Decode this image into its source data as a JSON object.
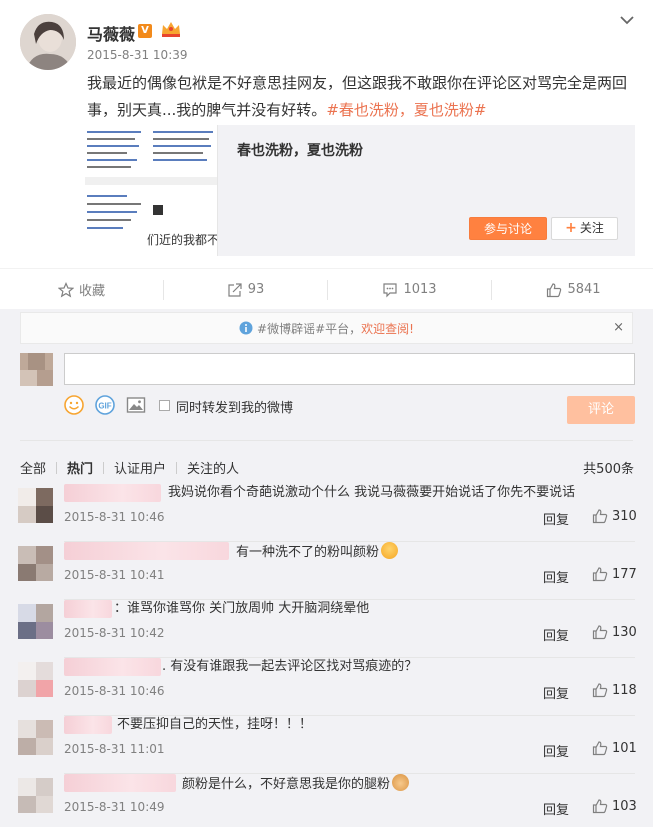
{
  "post": {
    "username": "马薇薇",
    "verified_mark": "V",
    "timestamp": "2015-8-31 10:39",
    "text": "我最近的偶像包袱是不好意思挂网友，但这跟我不敢跟你在评论区对骂完全是两回事，别天真...我的脾气并没有好转。",
    "hashtag": "#春也洗粉，夏也洗粉#",
    "card": {
      "title": "春也洗粉，夏也洗粉",
      "thumb_text": "们近的我都不敢",
      "discuss_label": "参与讨论",
      "follow_label": "关注",
      "follow_plus": "+"
    }
  },
  "actions": {
    "favorite_label": "收藏",
    "repost_count": "93",
    "comment_count": "1013",
    "like_count": "5841"
  },
  "notice": {
    "hash_text": "#微博辟谣#平台，",
    "link_text": "欢迎查阅!",
    "close": "×"
  },
  "composer": {
    "repost_label": "同时转发到我的微博",
    "submit_label": "评论",
    "gif_label": "GIF"
  },
  "filters": {
    "items": [
      "全部",
      "热门",
      "认证用户",
      "关注的人"
    ],
    "active": "热门",
    "total": "共500条"
  },
  "comments": [
    {
      "text": "我妈说你看个奇葩说激动个什么 我说马薇薇要开始说话了你先不要说话",
      "time": "2015-8-31 10:46",
      "reply": "回复",
      "likes": "310"
    },
    {
      "text": "有一种洗不了的粉叫颜粉",
      "time": "2015-8-31 10:41",
      "reply": "回复",
      "likes": "177"
    },
    {
      "text": "：谁骂你谁骂你 关门放周帅 大开脑洞绕晕他",
      "time": "2015-8-31 10:42",
      "reply": "回复",
      "likes": "130"
    },
    {
      "text": ". 有没有谁跟我一起去评论区找对骂痕迹的？",
      "time": "2015-8-31 10:46",
      "reply": "回复",
      "likes": "118"
    },
    {
      "text": "不要压抑自己的天性，挂呀！！！",
      "time": "2015-8-31 11:01",
      "reply": "回复",
      "likes": "101"
    },
    {
      "text": "颜粉是什么，不好意思我是你的腿粉",
      "time": "2015-8-31 10:49",
      "reply": "回复",
      "likes": "103"
    }
  ],
  "colors": {
    "accent": "#eb7350",
    "discuss_button": "#ff8140",
    "submit_button": "#ffc09f",
    "comment_bg": "#f2f2f5"
  }
}
